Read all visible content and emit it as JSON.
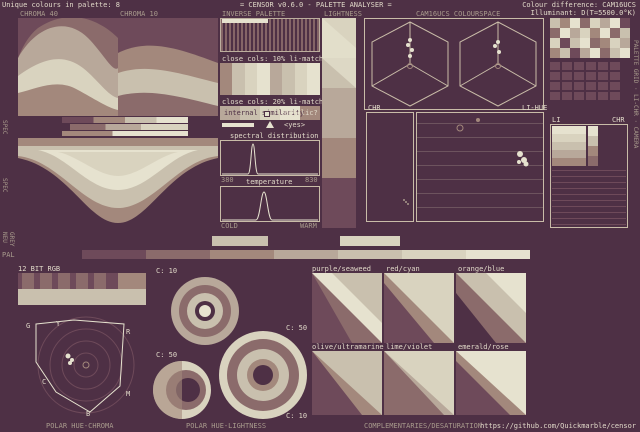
{
  "header": {
    "unique_colours": "Unique colours in palette: 8",
    "title": "= CENSOR v0.6.0 - PALETTE ANALYSER =",
    "colour_difference": "Colour difference: CAM16UCS",
    "illuminant": "Illuminant: D(T=5500.0°K)"
  },
  "labels": {
    "chroma_40": "CHROMA 40",
    "chroma_10": "CHROMA 10",
    "inverse_palette": "INVERSE PALETTE",
    "lightness": "LIGHTNESS",
    "cam16ucs_colourspace": "CAM16UCS COLOURSPACE",
    "close_cols_10": "close cols: 10% li-match",
    "close_cols_20": "close cols: 20% li-match",
    "internal_similarity": "internal similarity",
    "acyclic": "acyclic?",
    "yes": "<yes>",
    "spectral_distribution": "spectral distribution",
    "wl_min": "380",
    "wl_max": "830",
    "temperature": "temperature",
    "cold": "COLD",
    "warm": "WARM",
    "chr": "CHR",
    "li_hue": "LI-HUE",
    "li": "LI",
    "chr2": "CHR",
    "bit12": "12 BIT RGB",
    "c10a": "C: 10",
    "c50a": "C: 50",
    "c50b": "C: 50",
    "c10b": "C: 10",
    "polar_hue_chroma": "POLAR HUE-CHROMA",
    "polar_hue_lightness": "POLAR HUE-LIGHTNESS",
    "complementaries": "COMPLEMENTARIES/DESATURATION",
    "github": "https://github.com/Quickmarble/censor",
    "spec_left": "SPEC",
    "spec_left2": "SPEC",
    "neu": "NEU",
    "grey": "GREY",
    "pal": "PAL",
    "side_right": "PALETTE GRID · LI-CHR · CAMERA",
    "pair_purple": "purple/seaweed",
    "pair_red": "red/cyan",
    "pair_orange": "orange/blue",
    "pair_olive": "olive/ultramarine",
    "pair_lime": "lime/violet",
    "pair_emerald": "emerald/rose",
    "pol_g": "G",
    "pol_y": "Y",
    "pol_r": "R",
    "pol_c": "C",
    "pol_m": "M",
    "pol_b": "B"
  },
  "palette": [
    "#4e3045",
    "#6e4a5a",
    "#8b6b6b",
    "#a3887c",
    "#b8a89a",
    "#c9c0ae",
    "#d9d3bf",
    "#e6e2cf"
  ],
  "colors": {
    "bg": "#4e3045",
    "line": "#c9bca8",
    "dim": "#a89a8c",
    "accent": "#e6e2cf"
  }
}
